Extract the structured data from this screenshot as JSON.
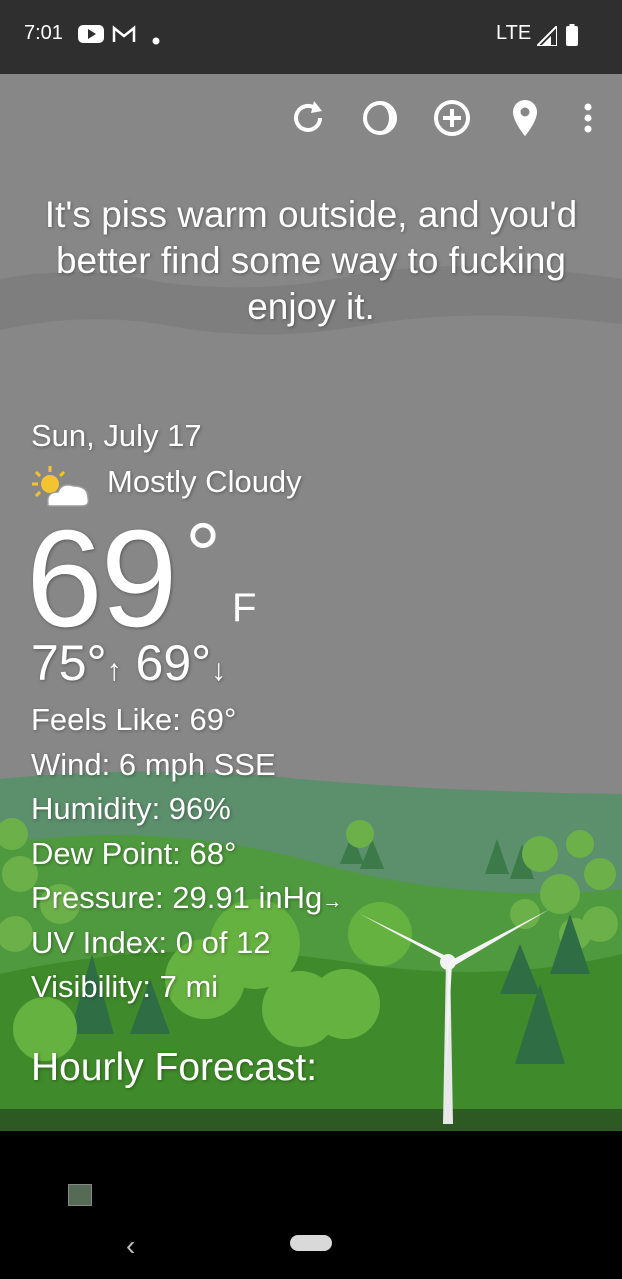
{
  "status_bar": {
    "time": "7:01",
    "network": "LTE"
  },
  "toolbar": {
    "icons": [
      "refresh-icon",
      "moon-icon",
      "add-icon",
      "location-pin-icon",
      "more-vert-icon"
    ]
  },
  "quote": "It's piss warm outside, and you'd better find some way to fucking enjoy it.",
  "weather": {
    "date": "Sun, July 17",
    "condition": "Mostly Cloudy",
    "temperature": "69",
    "degree_symbol": "°",
    "unit": "F",
    "high": "75°",
    "high_arrow": "↑",
    "low": "69°",
    "low_arrow": "↓",
    "feels_like": "Feels Like:  69°",
    "wind": "Wind:  6 mph SSE",
    "humidity": "Humidity:  96%",
    "dew_point": "Dew Point:  68°",
    "pressure": "Pressure:  29.91 inHg",
    "pressure_trend": "→",
    "uv_index": "UV Index:  0 of 12",
    "visibility": "Visibility:  7 mi"
  },
  "hourly_heading": "Hourly Forecast:",
  "nav": {
    "back": "‹"
  },
  "colors": {
    "status_bar": "#2f2f2f",
    "sky": "#878787",
    "hill_far": "#5c8f6c",
    "hill_mid": "#4f9a3e",
    "hill_near": "#3f8a2a",
    "tree_light": "#66b240",
    "tree_dark": "#2f6e45"
  }
}
